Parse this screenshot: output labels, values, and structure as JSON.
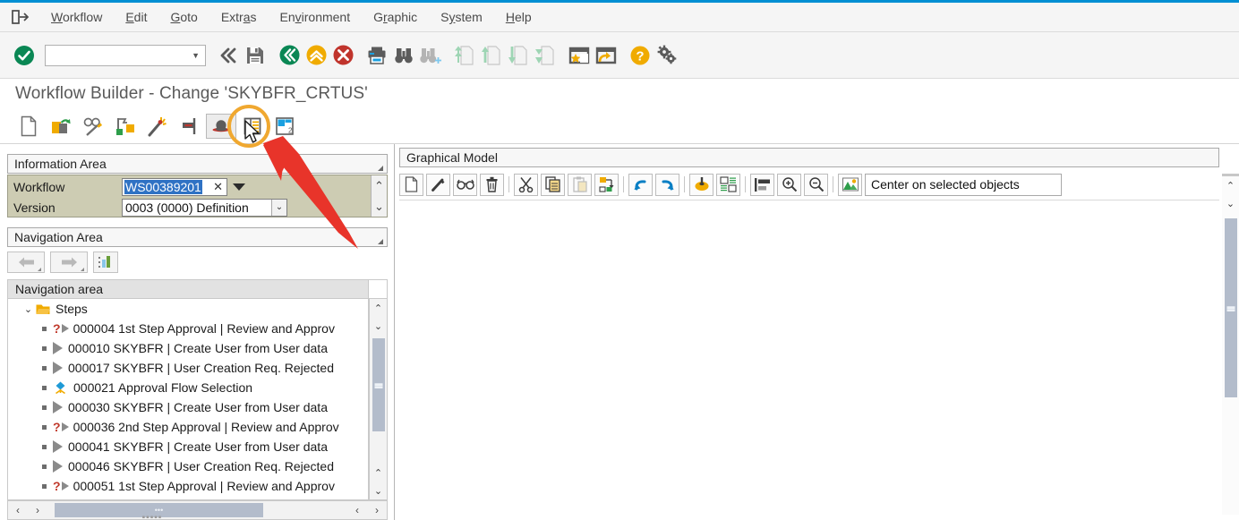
{
  "menubar": {
    "system_icon": "system-menu-icon",
    "items": [
      {
        "label": "Workflow",
        "accel": "W"
      },
      {
        "label": "Edit",
        "accel": "E"
      },
      {
        "label": "Goto",
        "accel": "G"
      },
      {
        "label": "Extras",
        "accel": "a"
      },
      {
        "label": "Environment",
        "accel": "v"
      },
      {
        "label": "Graphic",
        "accel": "r"
      },
      {
        "label": "System",
        "accel": "y"
      },
      {
        "label": "Help",
        "accel": "H"
      }
    ]
  },
  "standard_toolbar": {
    "enter_icon": "green-check-enter-icon",
    "command_field_value": "",
    "command_field_placeholder": "",
    "dropdown_icon": "chevron-down-icon",
    "icons": [
      "back-double-chevron-icon",
      "save-floppy-icon",
      "back-green-icon",
      "exit-yellow-icon",
      "cancel-red-icon",
      "print-icon",
      "find-binoculars-icon",
      "find-next-binoculars-icon",
      "first-page-icon",
      "previous-page-icon",
      "next-page-icon",
      "last-page-icon",
      "create-session-icon",
      "create-shortcut-icon",
      "help-icon",
      "customize-local-layout-icon"
    ]
  },
  "title": {
    "text": "Workflow Builder - Change 'SKYBFR_CRTUS'"
  },
  "app_toolbar": {
    "buttons": [
      {
        "name": "new-workflow-button",
        "icon": "blank-page-icon",
        "selected": false
      },
      {
        "name": "open-workflow-button",
        "icon": "open-folder-icon",
        "selected": false
      },
      {
        "name": "display-change-button",
        "icon": "glasses-pencil-icon",
        "selected": false
      },
      {
        "name": "workflow-version-button",
        "icon": "flag-build-icon",
        "selected": false
      },
      {
        "name": "wizard-button",
        "icon": "magic-wand-icon",
        "selected": false
      },
      {
        "name": "workflow-stop-button",
        "icon": "signal-stop-icon",
        "selected": false
      },
      {
        "name": "basic-data-button",
        "icon": "bowler-hat-icon",
        "selected": true
      },
      {
        "name": "workflow-container-button",
        "icon": "container-list-icon",
        "selected": false
      },
      {
        "name": "second-view-button",
        "icon": "split-view-2-icon",
        "selected": false
      }
    ]
  },
  "information_area": {
    "header": "Information Area",
    "fields": [
      {
        "label": "Workflow",
        "value": "WS00389201",
        "clear_icon": "clear-x-icon",
        "dropdown_icon": "value-help-arrow-icon",
        "selected": true
      },
      {
        "label": "Version",
        "value": "0003 (0000) Definition",
        "dropdown_icon": "chevron-down-icon"
      }
    ],
    "scroll_up_icon": "chevron-up-icon",
    "scroll_down_icon": "chevron-down-icon"
  },
  "navigation_area": {
    "header": "Navigation Area",
    "buttons": [
      {
        "name": "nav-back-button",
        "icon": "left-arrow-icon"
      },
      {
        "name": "nav-forward-button",
        "icon": "right-arrow-icon"
      },
      {
        "name": "nav-overview-button",
        "icon": "overview-chart-icon"
      }
    ],
    "tree_title": "Navigation area",
    "tree": {
      "root": {
        "label": "Steps",
        "icon": "folder-icon",
        "twisty": "⌄",
        "expanded": true
      },
      "items": [
        {
          "id": "000004",
          "text": "000004 1st Step Approval | Review and Approv",
          "icon": "decision-step-icon",
          "has_question": true
        },
        {
          "id": "000010",
          "text": "000010 SKYBFR | Create User from User data",
          "icon": "activity-step-icon",
          "has_question": false
        },
        {
          "id": "000017",
          "text": "000017 SKYBFR | User Creation Req. Rejected",
          "icon": "activity-step-icon",
          "has_question": false
        },
        {
          "id": "000021",
          "text": "000021 Approval Flow Selection",
          "icon": "fork-step-icon",
          "has_question": false
        },
        {
          "id": "000030",
          "text": "000030 SKYBFR | Create User from User data",
          "icon": "activity-step-icon",
          "has_question": false
        },
        {
          "id": "000036",
          "text": "000036 2nd Step Approval | Review and Approv",
          "icon": "decision-step-icon",
          "has_question": true
        },
        {
          "id": "000041",
          "text": "000041 SKYBFR | Create User from User data",
          "icon": "activity-step-icon",
          "has_question": false
        },
        {
          "id": "000046",
          "text": "000046 SKYBFR | User Creation Req. Rejected",
          "icon": "activity-step-icon",
          "has_question": false
        },
        {
          "id": "000051",
          "text": "000051 1st Step Approval | Review and Approv",
          "icon": "decision-step-icon",
          "has_question": true
        }
      ]
    },
    "hscroll": {
      "left_icon": "‹",
      "right_icon": "›",
      "grip": "•••"
    }
  },
  "graphical_model": {
    "header": "Graphical Model",
    "toolbar": [
      {
        "name": "gm-create-button",
        "icon": "blank-page-icon"
      },
      {
        "name": "gm-change-button",
        "icon": "pencil-icon"
      },
      {
        "name": "gm-display-button",
        "icon": "glasses-icon"
      },
      {
        "name": "gm-delete-button",
        "icon": "trash-icon"
      },
      {
        "name": "gm-cut-button",
        "icon": "scissors-icon"
      },
      {
        "name": "gm-copy-button",
        "icon": "copy-icon"
      },
      {
        "name": "gm-paste-button",
        "icon": "paste-icon"
      },
      {
        "name": "gm-insert-button",
        "icon": "insert-node-icon"
      },
      {
        "name": "gm-undo-button",
        "icon": "undo-arrow-icon"
      },
      {
        "name": "gm-redo-button",
        "icon": "redo-arrow-icon"
      },
      {
        "name": "gm-highlight-button",
        "icon": "highlighter-icon"
      },
      {
        "name": "gm-layout-button",
        "icon": "layout-grid-icon"
      },
      {
        "name": "gm-align-button",
        "icon": "align-left-icon"
      },
      {
        "name": "gm-zoom-in-button",
        "icon": "zoom-in-icon"
      },
      {
        "name": "gm-zoom-out-button",
        "icon": "zoom-out-icon"
      },
      {
        "name": "gm-center-button",
        "icon": "center-image-icon"
      }
    ],
    "center_combo_value": "Center on selected objects"
  },
  "annotations": {
    "highlight_circle_color": "#f0a830",
    "arrow_color": "#e8342a",
    "cursor_icon": "mouse-pointer-icon"
  }
}
